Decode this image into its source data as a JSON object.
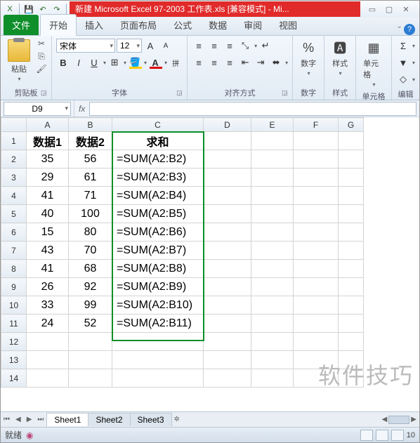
{
  "title": "新建 Microsoft Excel 97-2003 工作表.xls  [兼容模式]  -  Mi...",
  "tabs": {
    "file": "文件",
    "home": "开始",
    "insert": "插入",
    "layout": "页面布局",
    "formula": "公式",
    "data": "数据",
    "review": "审阅",
    "view": "视图"
  },
  "ribbon": {
    "clipboard": {
      "title": "剪贴板",
      "paste": "粘贴"
    },
    "font": {
      "title": "字体",
      "name": "宋体",
      "size": "12",
      "b": "B",
      "i": "I",
      "u": "U"
    },
    "align": {
      "title": "对齐方式"
    },
    "number": {
      "title": "数字",
      "label": "数字",
      "percent": "%"
    },
    "style": {
      "title": "样式",
      "label": "样式"
    },
    "cells": {
      "title": "单元格",
      "label": "单元格"
    },
    "edit": {
      "title": "编辑",
      "sigma": "Σ"
    }
  },
  "namebox": "D9",
  "fx": "fx",
  "columns": [
    "A",
    "B",
    "C",
    "D",
    "E",
    "F",
    "G"
  ],
  "headers": {
    "a": "数据1",
    "b": "数据2",
    "c": "求和"
  },
  "rows": [
    {
      "n": 2,
      "a": "35",
      "b": "56",
      "c": "=SUM(A2:B2)"
    },
    {
      "n": 3,
      "a": "29",
      "b": "61",
      "c": "=SUM(A2:B3)"
    },
    {
      "n": 4,
      "a": "41",
      "b": "71",
      "c": "=SUM(A2:B4)"
    },
    {
      "n": 5,
      "a": "40",
      "b": "100",
      "c": "=SUM(A2:B5)"
    },
    {
      "n": 6,
      "a": "15",
      "b": "80",
      "c": "=SUM(A2:B6)"
    },
    {
      "n": 7,
      "a": "43",
      "b": "70",
      "c": "=SUM(A2:B7)"
    },
    {
      "n": 8,
      "a": "41",
      "b": "68",
      "c": "=SUM(A2:B8)"
    },
    {
      "n": 9,
      "a": "26",
      "b": "92",
      "c": "=SUM(A2:B9)"
    },
    {
      "n": 10,
      "a": "33",
      "b": "99",
      "c": "=SUM(A2:B10)"
    },
    {
      "n": 11,
      "a": "24",
      "b": "52",
      "c": "=SUM(A2:B11)"
    }
  ],
  "empty_rows": [
    12,
    13,
    14
  ],
  "sheets": {
    "s1": "Sheet1",
    "s2": "Sheet2",
    "s3": "Sheet3"
  },
  "status": {
    "ready": "就绪",
    "zoom": "10"
  },
  "watermark": "软件技巧"
}
